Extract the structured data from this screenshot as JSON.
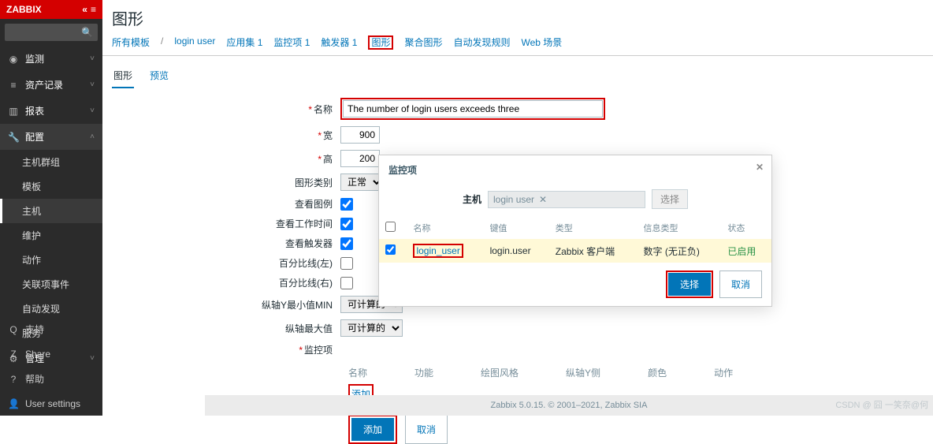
{
  "logo": "ZABBIX",
  "collapse_icon": "«",
  "search": {
    "placeholder": ""
  },
  "sidebar": {
    "groups": [
      {
        "icon": "◉",
        "label": "监测",
        "expanded": false
      },
      {
        "icon": "≡",
        "label": "资产记录",
        "expanded": false
      },
      {
        "icon": "▥",
        "label": "报表",
        "expanded": false
      },
      {
        "icon": "🔧",
        "label": "配置",
        "expanded": true,
        "items": [
          {
            "label": "主机群组"
          },
          {
            "label": "模板"
          },
          {
            "label": "主机",
            "active": true
          },
          {
            "label": "维护"
          },
          {
            "label": "动作"
          },
          {
            "label": "关联项事件"
          },
          {
            "label": "自动发现"
          },
          {
            "label": "服务"
          }
        ]
      },
      {
        "icon": "⚙",
        "label": "管理",
        "expanded": false
      }
    ],
    "bottom": [
      {
        "icon": "Q",
        "label": "支持"
      },
      {
        "icon": "Z",
        "label": "Share"
      },
      {
        "icon": "?",
        "label": "帮助"
      },
      {
        "icon": "👤",
        "label": "User settings"
      }
    ]
  },
  "page_title": "图形",
  "breadcrumbs": [
    {
      "label": "所有模板"
    },
    {
      "sep": "/"
    },
    {
      "label": "login user"
    },
    {
      "label": "应用集 1"
    },
    {
      "label": "监控项 1"
    },
    {
      "label": "触发器 1"
    },
    {
      "label": "图形",
      "highlight": true
    },
    {
      "label": "聚合图形"
    },
    {
      "label": "自动发现规则"
    },
    {
      "label": "Web 场景"
    }
  ],
  "tabs": [
    {
      "label": "图形",
      "active": true
    },
    {
      "label": "预览"
    }
  ],
  "form": {
    "name_label": "名称",
    "name_value": "The number of login users exceeds three",
    "width_label": "宽",
    "width_value": "900",
    "height_label": "高",
    "height_value": "200",
    "gtype_label": "图形类别",
    "gtype_value": "正常",
    "legend_label": "查看图例",
    "legend_checked": true,
    "worktime_label": "查看工作时间",
    "worktime_checked": true,
    "triggers_label": "查看触发器",
    "triggers_checked": true,
    "pleft_label": "百分比线(左)",
    "pleft_checked": false,
    "pright_label": "百分比线(右)",
    "pright_checked": false,
    "ymin_label": "纵轴Y最小值MIN",
    "ymin_value": "可计算的",
    "ymax_label": "纵轴最大值",
    "ymax_value": "可计算的",
    "items_label": "监控项",
    "item_cols": [
      "名称",
      "功能",
      "绘图风格",
      "纵轴Y侧",
      "颜色",
      "动作"
    ],
    "add_link": "添加",
    "submit": "添加",
    "cancel": "取消"
  },
  "modal": {
    "title": "监控项",
    "close": "✕",
    "host_label": "主机",
    "host_value": "login user",
    "select_btn": "选择",
    "cols": [
      "",
      "名称",
      "键值",
      "类型",
      "信息类型",
      "状态"
    ],
    "row": {
      "checked": true,
      "name": "login_user",
      "key": "login.user",
      "type": "Zabbix 客户端",
      "info": "数字 (无正负)",
      "status": "已启用"
    },
    "ok": "选择",
    "cancel": "取消"
  },
  "footer": "Zabbix 5.0.15. © 2001–2021, Zabbix SIA",
  "watermark": "CSDN @ 囧 一笑奈@何"
}
